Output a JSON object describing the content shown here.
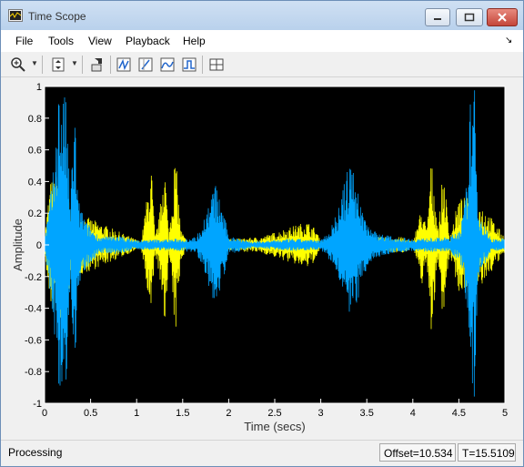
{
  "window": {
    "title": "Time Scope"
  },
  "menu": [
    "File",
    "Tools",
    "View",
    "Playback",
    "Help"
  ],
  "status": {
    "text": "Processing",
    "offset": "Offset=10.534",
    "time": "T=15.5109"
  },
  "colors": {
    "plot_bg": "#000000",
    "series_yellow": "#ffff00",
    "series_blue": "#00a5ff",
    "axis_text": "#ffffff"
  },
  "chart_data": {
    "type": "line",
    "xlabel": "Time (secs)",
    "ylabel": "Amplitude",
    "xlim": [
      0,
      5
    ],
    "ylim": [
      -1,
      1
    ],
    "x_ticks": [
      "0",
      "0.5",
      "1",
      "1.5",
      "2",
      "2.5",
      "3",
      "3.5",
      "4",
      "4.5",
      "5"
    ],
    "y_ticks": [
      "-1",
      "-0.8",
      "-0.6",
      "-0.4",
      "-0.2",
      "0",
      "0.2",
      "0.4",
      "0.6",
      "0.8",
      "1"
    ],
    "grid": false,
    "series": [
      {
        "color": "#ffff00",
        "envelope": [
          [
            0.0,
            0.06
          ],
          [
            0.06,
            0.4
          ],
          [
            0.2,
            0.5
          ],
          [
            0.3,
            0.2
          ],
          [
            0.45,
            0.18
          ],
          [
            1.05,
            0.02
          ],
          [
            1.1,
            0.25
          ],
          [
            1.16,
            0.5
          ],
          [
            1.2,
            0.05
          ],
          [
            1.25,
            0.2
          ],
          [
            1.3,
            0.6
          ],
          [
            1.35,
            0.05
          ],
          [
            1.42,
            0.6
          ],
          [
            1.48,
            0.1
          ],
          [
            1.55,
            0.02
          ],
          [
            2.35,
            0.05
          ],
          [
            2.85,
            0.15
          ],
          [
            2.95,
            0.1
          ],
          [
            3.0,
            0.02
          ],
          [
            3.4,
            0.05
          ],
          [
            3.9,
            0.05
          ],
          [
            4.0,
            0.02
          ],
          [
            4.1,
            0.25
          ],
          [
            4.15,
            0.1
          ],
          [
            4.2,
            0.55
          ],
          [
            4.28,
            0.1
          ],
          [
            4.33,
            0.5
          ],
          [
            4.4,
            0.05
          ],
          [
            4.5,
            0.3
          ],
          [
            4.7,
            0.3
          ],
          [
            5.0,
            0.05
          ]
        ]
      },
      {
        "color": "#00a5ff",
        "envelope": [
          [
            0.0,
            0.04
          ],
          [
            0.05,
            0.25
          ],
          [
            0.1,
            0.5
          ],
          [
            0.15,
            1.0
          ],
          [
            0.2,
            1.0
          ],
          [
            0.24,
            0.9
          ],
          [
            0.28,
            0.2
          ],
          [
            0.3,
            0.6
          ],
          [
            0.33,
            0.9
          ],
          [
            0.36,
            0.3
          ],
          [
            0.45,
            0.15
          ],
          [
            0.6,
            0.05
          ],
          [
            0.8,
            0.06
          ],
          [
            1.0,
            0.03
          ],
          [
            1.5,
            0.04
          ],
          [
            1.65,
            0.05
          ],
          [
            1.75,
            0.2
          ],
          [
            1.85,
            0.4
          ],
          [
            1.95,
            0.2
          ],
          [
            2.0,
            0.05
          ],
          [
            2.1,
            0.05
          ],
          [
            2.25,
            0.02
          ],
          [
            2.7,
            0.04
          ],
          [
            3.0,
            0.03
          ],
          [
            3.1,
            0.1
          ],
          [
            3.2,
            0.25
          ],
          [
            3.3,
            0.5
          ],
          [
            3.35,
            0.55
          ],
          [
            3.4,
            0.35
          ],
          [
            3.5,
            0.15
          ],
          [
            3.6,
            0.08
          ],
          [
            3.8,
            0.05
          ],
          [
            4.0,
            0.04
          ],
          [
            4.4,
            0.05
          ],
          [
            4.5,
            0.1
          ],
          [
            4.55,
            0.2
          ],
          [
            4.6,
            0.5
          ],
          [
            4.63,
            1.0
          ],
          [
            4.67,
            1.0
          ],
          [
            4.72,
            0.2
          ],
          [
            4.85,
            0.04
          ],
          [
            5.0,
            0.04
          ]
        ]
      }
    ]
  }
}
